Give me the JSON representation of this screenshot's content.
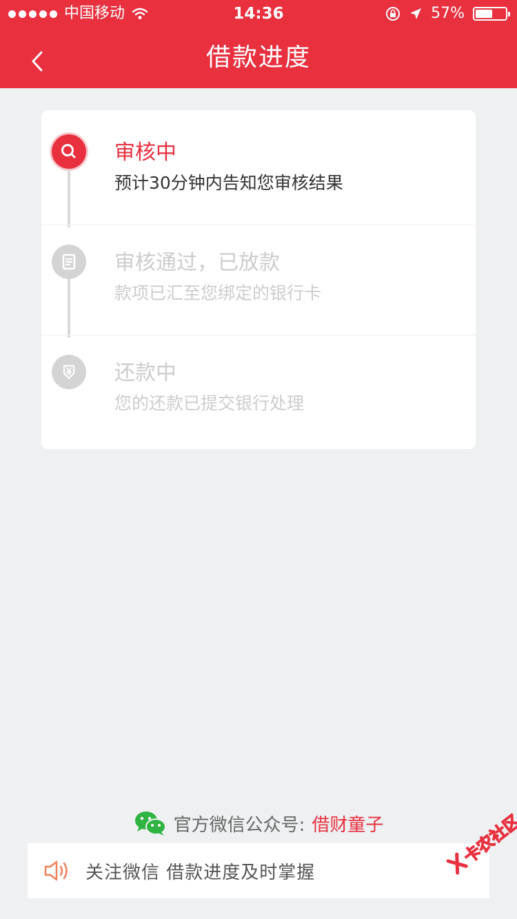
{
  "status_bar": {
    "carrier": "中国移动",
    "time": "14:36",
    "battery": "57%",
    "battery_level": 0.57
  },
  "nav": {
    "title": "借款进度",
    "back_icon": "chevron-left-icon"
  },
  "steps": [
    {
      "title": "审核中",
      "desc": "预计30分钟内告知您审核结果",
      "icon": "search-icon",
      "active": true
    },
    {
      "title": "审核通过，已放款",
      "desc": "款项已汇至您绑定的银行卡",
      "icon": "document-icon",
      "active": false
    },
    {
      "title": "还款中",
      "desc": "您的还款已提交银行处理",
      "icon": "yen-down-icon",
      "active": false
    }
  ],
  "footer": {
    "wechat_label": "官方微信公众号:",
    "wechat_account": "借财童子",
    "notice": "关注微信 借款进度及时掌握"
  },
  "watermark": {
    "text": "卡农社区"
  },
  "colors": {
    "brand": "#e8303f",
    "active_text": "#e8303f",
    "inactive_text": "#cccccc",
    "inactive_icon": "#d4d4d4",
    "wechat_green": "#2fb342",
    "notice_icon": "#f07f5a"
  }
}
